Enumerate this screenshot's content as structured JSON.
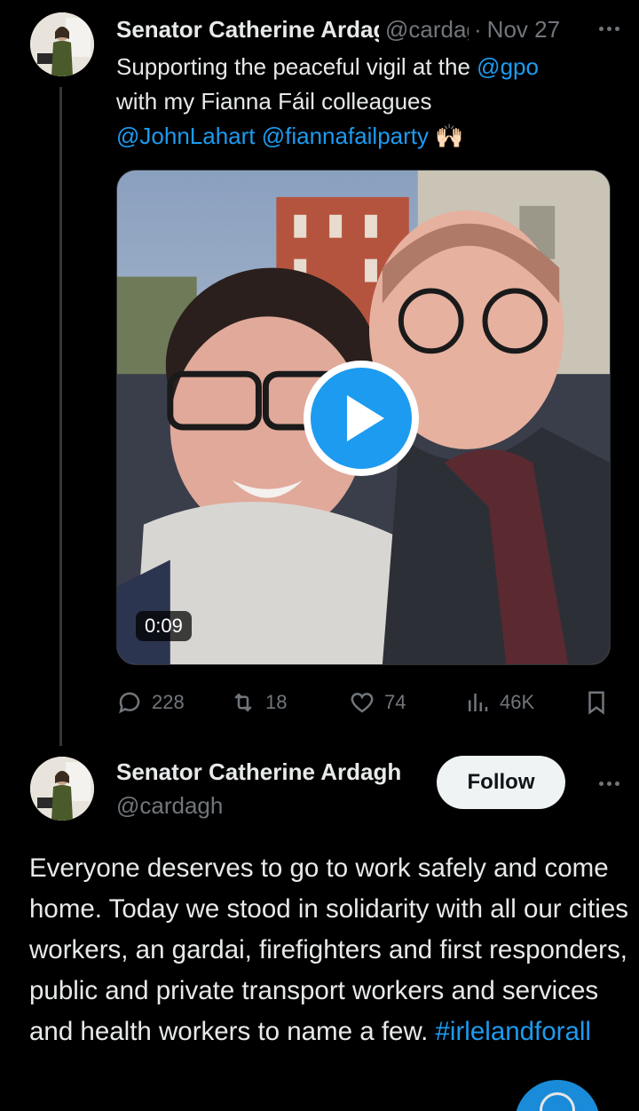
{
  "tweet1": {
    "author_name": "Senator Catherine Ardagh",
    "handle": "@cardagh",
    "separator": "·",
    "date": "Nov 27",
    "text_plain_1": "Supporting the peaceful vigil at the ",
    "mention_1": "@gpo",
    "text_plain_2": "with my Fianna Fáil colleagues",
    "mention_2": "@JohnLahart",
    "mention_3": "@fiannafailparty",
    "emoji": "🙌🏻",
    "video_duration": "0:09",
    "stats": {
      "replies": "228",
      "retweets": "18",
      "likes": "74",
      "views": "46K"
    }
  },
  "tweet2": {
    "author_name": "Senator Catherine Ardagh",
    "handle": "@cardagh",
    "follow_label": "Follow",
    "text_body": "Everyone deserves to go to work safely and come home. Today we stood in solidarity with all our cities workers, an gardai, firefighters and first responders, public and private transport workers and services and health workers to name a few. ",
    "hashtag": "#irlelandforall"
  },
  "colors": {
    "background": "#000000",
    "text_primary": "#e7e9ea",
    "text_secondary": "#71767b",
    "accent": "#1d9bf0",
    "follow_bg": "#eff3f4"
  }
}
